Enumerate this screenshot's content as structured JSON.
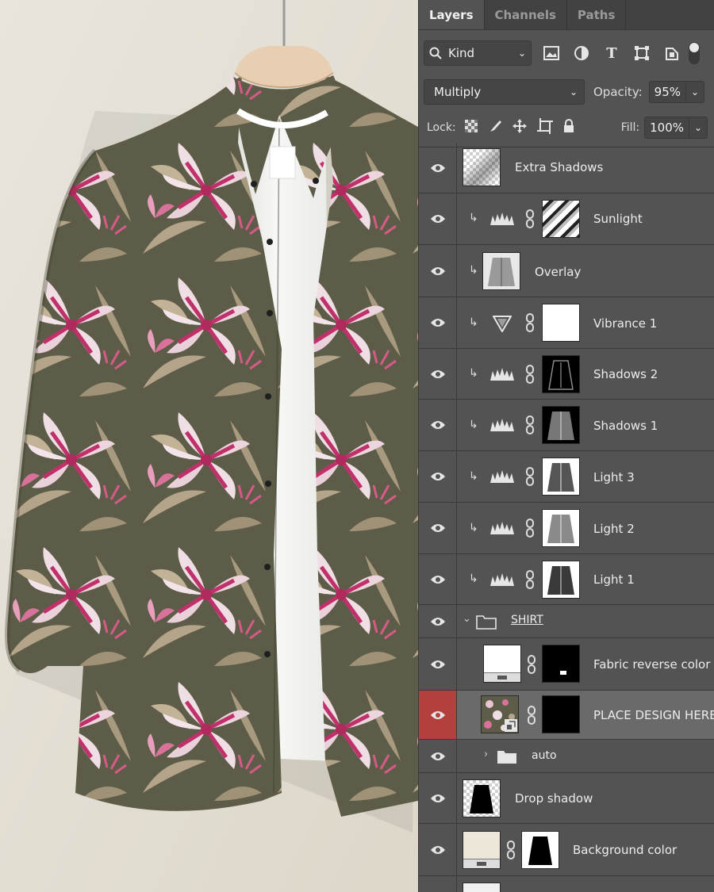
{
  "canvas": {
    "background": "#e6e1d6",
    "shirt_base": "#5d5c48",
    "flower_pink": "#d9729a",
    "flower_light": "#efdfe4",
    "leaf": "#b4a489",
    "tee": "#f6f6f4",
    "hanger": "#e8cfb4"
  },
  "panel": {
    "tabs": [
      "Layers",
      "Channels",
      "Paths"
    ],
    "filter": {
      "label": "Kind"
    },
    "blend_mode": "Multiply",
    "opacity_label": "Opacity:",
    "opacity_value": "95%",
    "lock_label": "Lock:",
    "fill_label": "Fill:",
    "fill_value": "100%"
  },
  "layers": [
    {
      "name": "Extra Shadows"
    },
    {
      "name": "Sunlight"
    },
    {
      "name": "Overlay"
    },
    {
      "name": "Vibrance 1"
    },
    {
      "name": "Shadows 2"
    },
    {
      "name": "Shadows 1"
    },
    {
      "name": "Light 3"
    },
    {
      "name": "Light 2"
    },
    {
      "name": "Light 1"
    },
    {
      "name": "SHIRT"
    },
    {
      "name": "Fabric reverse color"
    },
    {
      "name": "PLACE DESIGN HERE"
    },
    {
      "name": "auto"
    },
    {
      "name": "Drop shadow"
    },
    {
      "name": "Background color"
    }
  ],
  "colors": {
    "panel_bg": "#535353",
    "selected_eye": "#b33f3f",
    "selected_row": "#6a6a6a"
  }
}
